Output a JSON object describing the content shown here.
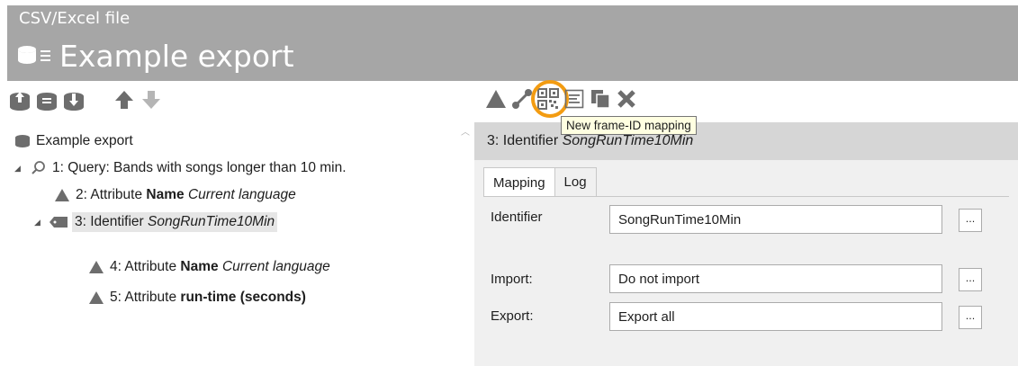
{
  "header": {
    "subtitle": "CSV/Excel file",
    "title": "Example export"
  },
  "left_toolbar": {
    "icons": [
      "export-up-icon",
      "export-middle-icon",
      "export-down-icon",
      "move-up-icon",
      "move-down-icon"
    ]
  },
  "tree": {
    "root": {
      "label": "Example export"
    },
    "query": {
      "label": "1: Query: Bands with songs longer than 10  min."
    },
    "attr2": {
      "prefix": "2: Attribute ",
      "bold": "Name",
      "italic": "Current language"
    },
    "ident3": {
      "prefix": "3: Identifier ",
      "italic": "SongRunTime10Min"
    },
    "attr4": {
      "prefix": "4: Attribute ",
      "bold": "Name",
      "italic": "Current language"
    },
    "attr5": {
      "prefix": "5: Attribute ",
      "bold": "run-time (seconds)"
    }
  },
  "right_toolbar": {
    "icons": [
      "attribute-icon",
      "relation-icon",
      "frame-id-mapping-icon",
      "list-icon",
      "copy-icon",
      "delete-icon"
    ],
    "tooltip": "New frame-ID mapping"
  },
  "panel": {
    "header_prefix": "3: Identifier ",
    "header_italic": "SongRunTime10Min",
    "tabs": [
      "Mapping",
      "Log"
    ],
    "active_tab": "Mapping",
    "fields": {
      "identifier": {
        "label": "Identifier",
        "value": "SongRunTime10Min",
        "button": "..."
      },
      "import": {
        "label": "Import:",
        "value": "Do not import",
        "button": "..."
      },
      "export": {
        "label": "Export:",
        "value": "Export all",
        "button": "..."
      }
    }
  },
  "colors": {
    "header_bg": "#a6a6a6",
    "icon_gray": "#6d6d6d",
    "highlight": "#f39c12",
    "tooltip_bg": "#ffffe1"
  }
}
